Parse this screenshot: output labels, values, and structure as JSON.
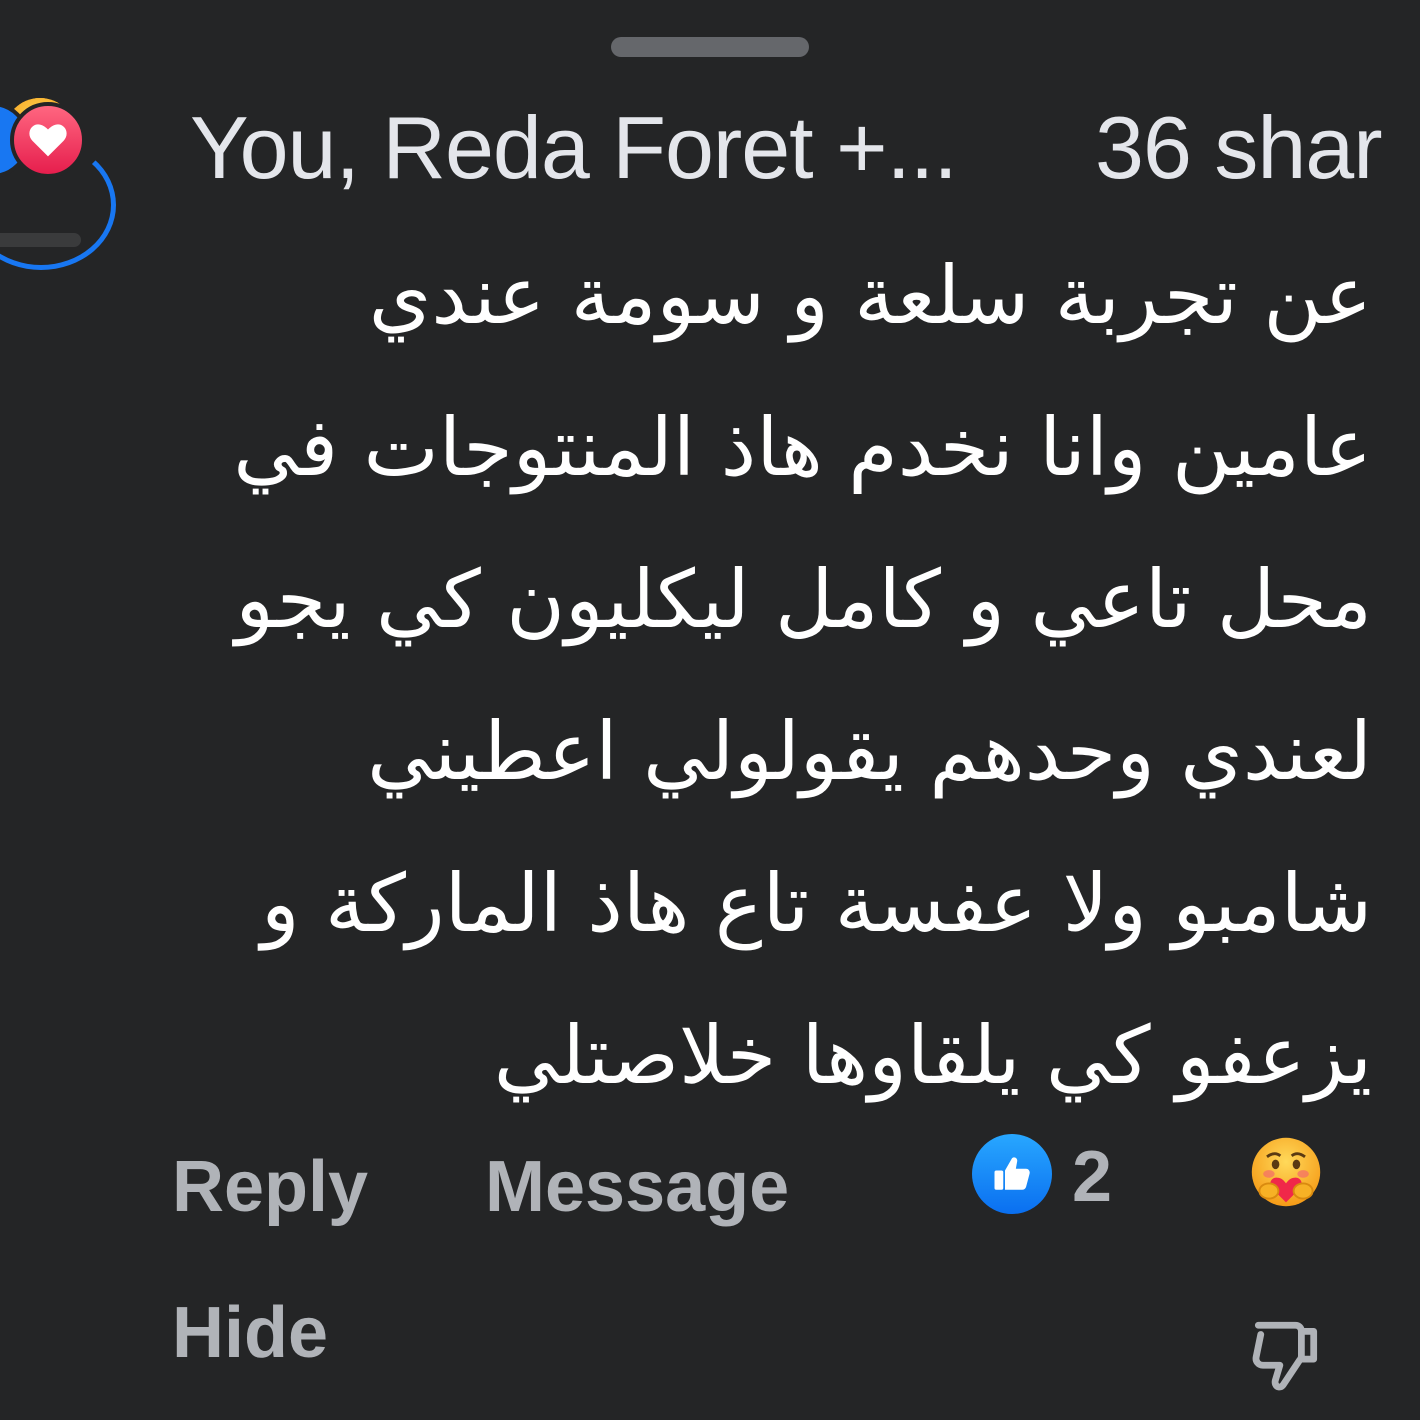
{
  "reactions_summary": {
    "reacted_by": "You, Reda Foret +...",
    "shares": "36 shar",
    "icons": [
      "like-icon",
      "love-icon",
      "care-icon"
    ]
  },
  "comment": {
    "lines": [
      "عن تجربة سلعة و سومة عندي",
      "عامين وانا نخدم هاذ المنتوجات في",
      "محل تاعي و كامل ليكليون كي يجو",
      "لعندي وحدهم يقولولي اعطيني",
      "شامبو ولا عفسة تاع هاذ الماركة و",
      "يزعفو كي يلقاوها خلاصتلي"
    ]
  },
  "actions": {
    "reply": "Reply",
    "message": "Message",
    "like_count": "2",
    "hide": "Hide"
  },
  "colors": {
    "background": "#242526",
    "primary_text": "#e4e6eb",
    "secondary_text": "#b0b3b8",
    "like_blue": "#1877f2",
    "love_red": "#e61e4d",
    "care_yellow": "#f7b125"
  }
}
